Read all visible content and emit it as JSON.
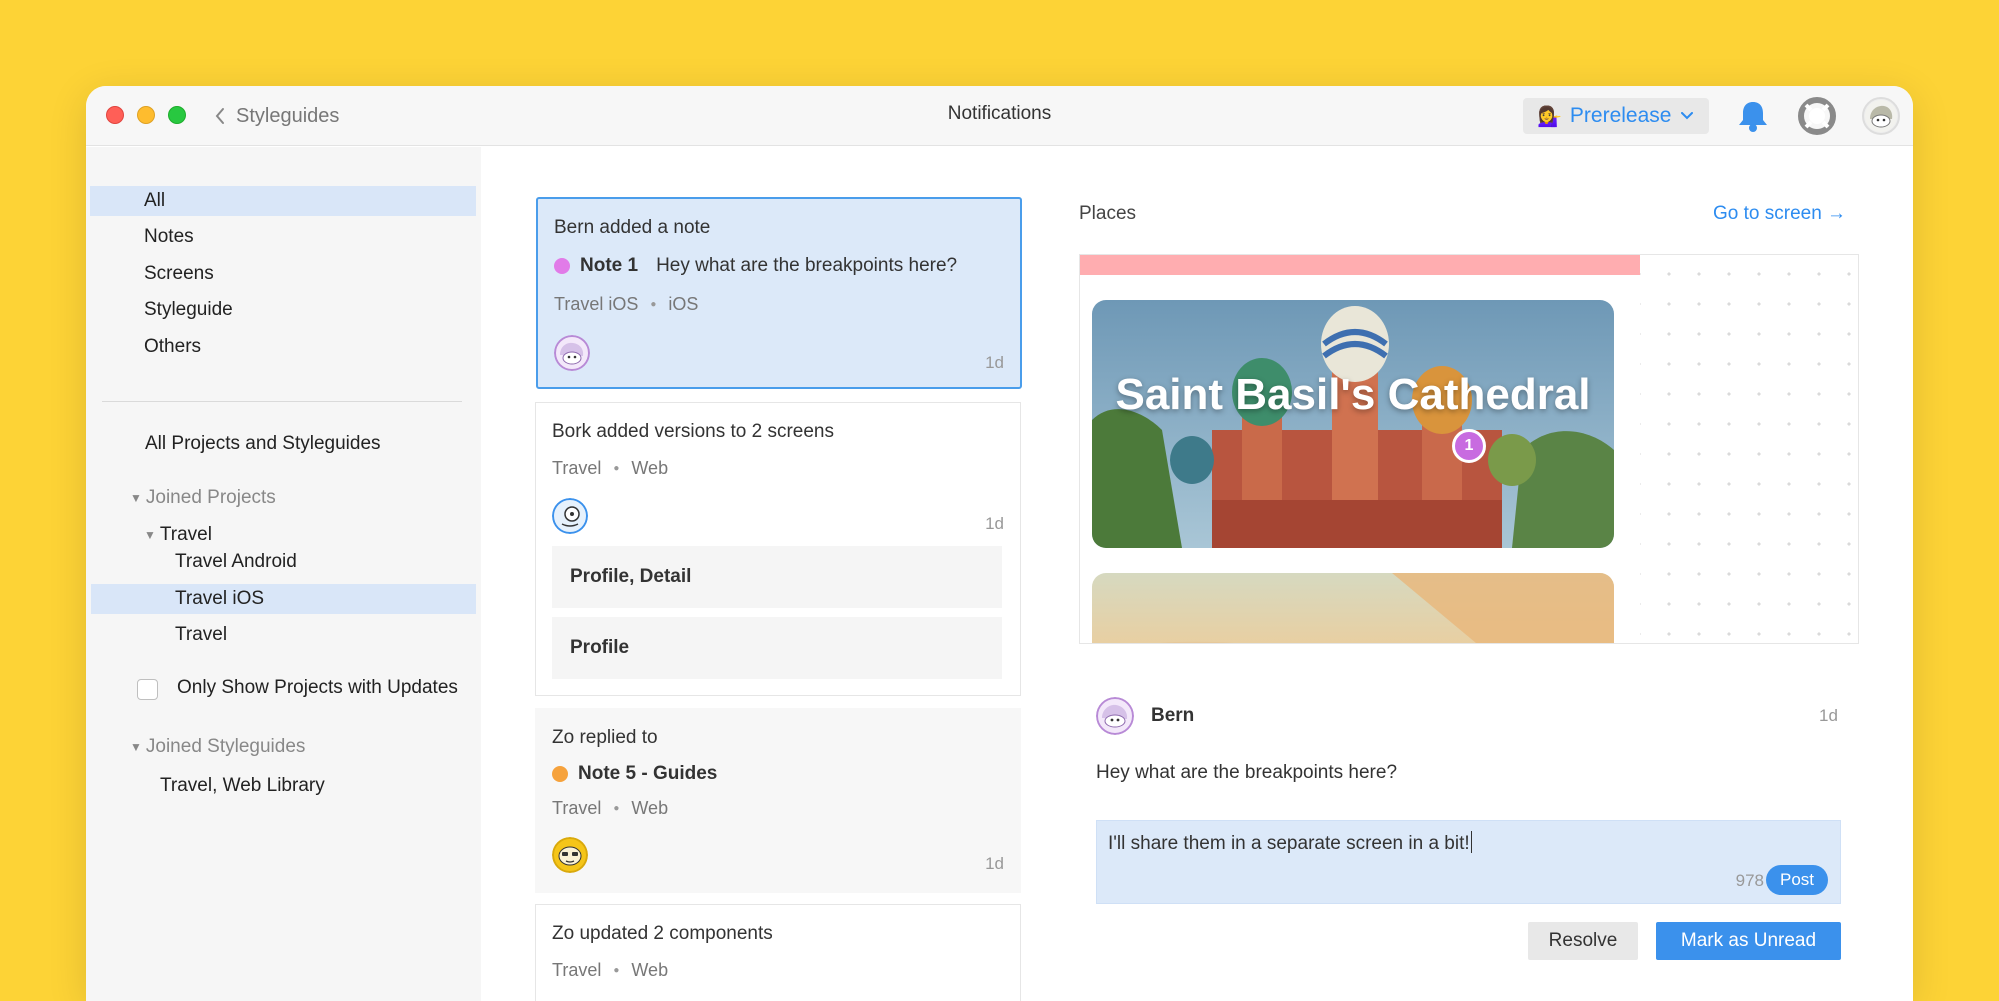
{
  "window": {
    "back_label": "Styleguides",
    "title": "Notifications",
    "prerelease": {
      "emoji": "💁‍♀️",
      "label": "Prerelease"
    }
  },
  "colors": {
    "background": "#FDD336",
    "accent": "#2D8CF0",
    "selection": "#D9E6F8",
    "note_pink": "#E17BE8",
    "note_orange": "#F6A23C"
  },
  "sidebar": {
    "filters": [
      "All",
      "Notes",
      "Screens",
      "Styleguide",
      "Others"
    ],
    "projects_heading": "All Projects and Styleguides",
    "joined_projects": "Joined Projects",
    "travel_group": "Travel",
    "projects": [
      "Travel Android",
      "Travel iOS",
      "Travel"
    ],
    "only_show_label": "Only Show Projects with Updates",
    "joined_styleguides": "Joined Styleguides",
    "styleguides": [
      "Travel, Web Library"
    ]
  },
  "notifications": [
    {
      "title": "Bern added a note",
      "note_name": "Note 1",
      "note_text": "Hey what are the breakpoints here?",
      "project": "Travel iOS",
      "platform": "iOS",
      "time": "1d"
    },
    {
      "title": "Bork added versions to 2 screens",
      "project": "Travel",
      "platform": "Web",
      "time": "1d",
      "screens": [
        "Profile, Detail",
        "Profile"
      ]
    },
    {
      "title": "Zo replied to",
      "note_name": "Note 5 - Guides",
      "project": "Travel",
      "platform": "Web",
      "time": "1d"
    },
    {
      "title": "Zo updated 2 components",
      "project": "Travel",
      "platform": "Web"
    }
  ],
  "detail": {
    "section": "Places",
    "goto_label": "Go to screen →",
    "hero_title": "Saint Basil's Cathedral",
    "pin_number": "1",
    "comment": {
      "author": "Bern",
      "time": "1d",
      "text": "Hey what are the breakpoints here?"
    },
    "reply": {
      "text": "I'll share them in a separate screen in a bit!",
      "char_count": "978",
      "post_label": "Post"
    },
    "resolve_label": "Resolve",
    "mark_unread_label": "Mark as Unread"
  }
}
